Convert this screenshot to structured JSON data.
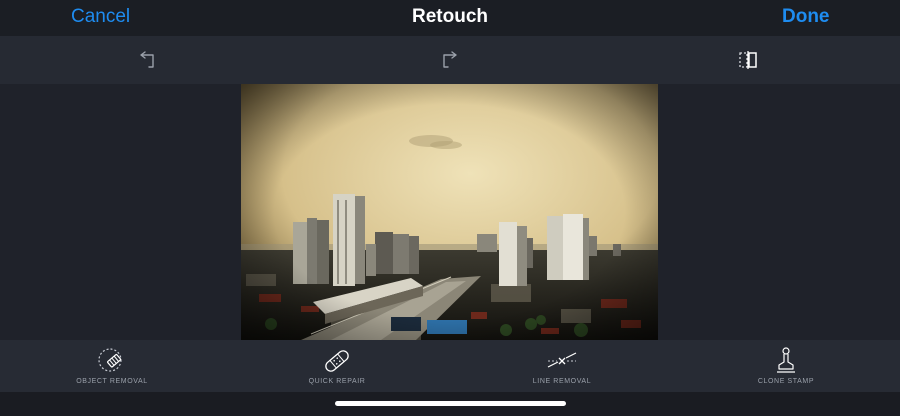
{
  "navbar": {
    "cancel_label": "Cancel",
    "title": "Retouch",
    "done_label": "Done"
  },
  "toolbar": {
    "icons": [
      "undo-icon",
      "redo-icon",
      "compare-icon"
    ]
  },
  "photo": {
    "subject": "city-skyline-photo"
  },
  "tools": [
    {
      "label": "OBJECT REMOVAL",
      "icon": "object-removal-icon"
    },
    {
      "label": "QUICK REPAIR",
      "icon": "bandage-icon"
    },
    {
      "label": "LINE REMOVAL",
      "icon": "line-removal-icon"
    },
    {
      "label": "CLONE STAMP",
      "icon": "clone-stamp-icon"
    }
  ],
  "colors": {
    "accent": "#1e8cf0",
    "background": "#20232b"
  }
}
